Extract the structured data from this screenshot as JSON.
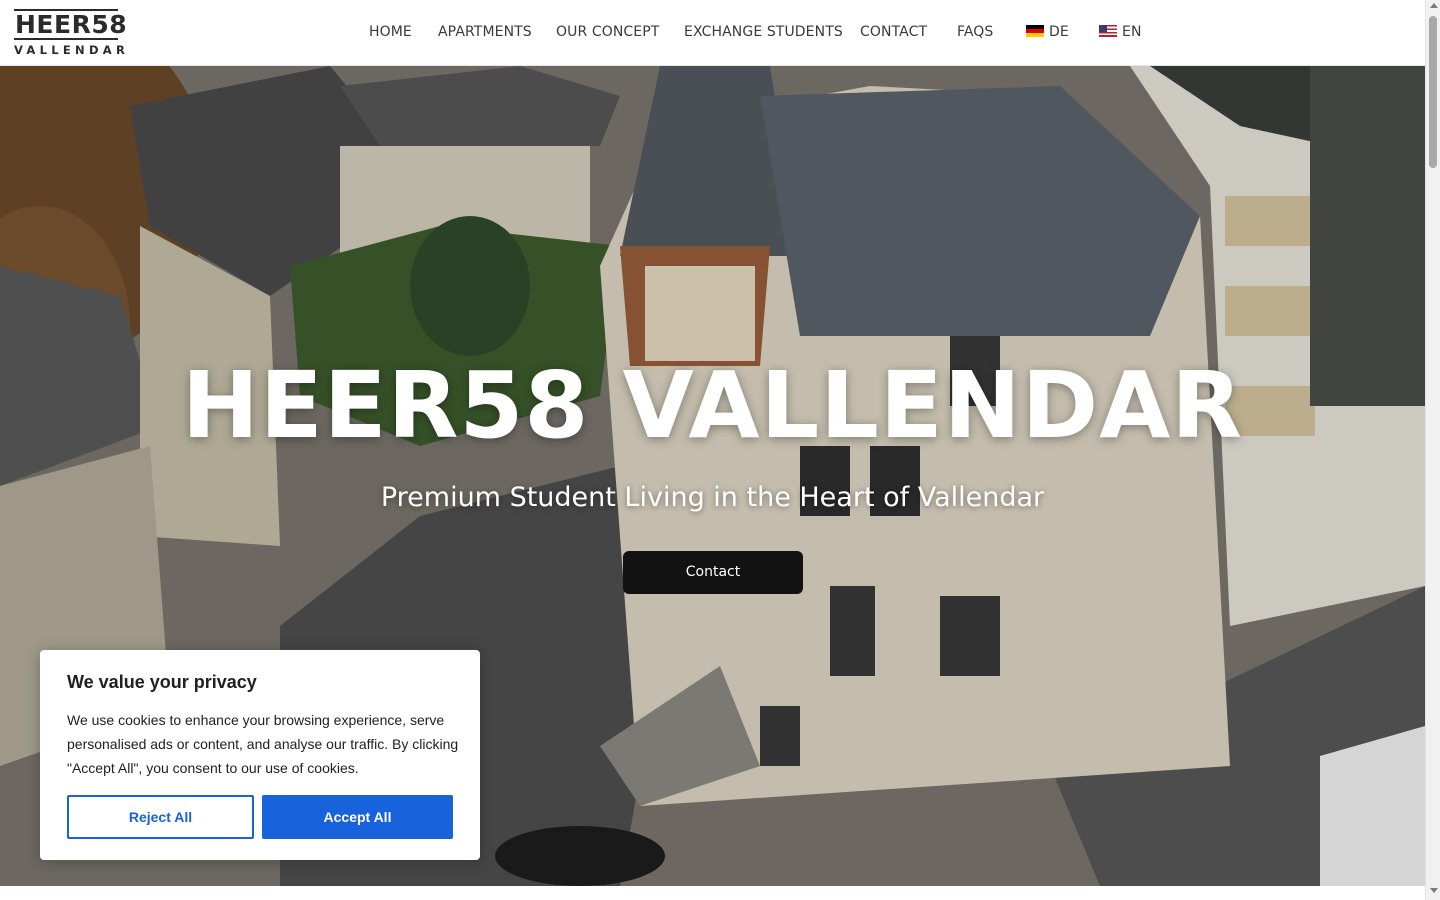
{
  "logo": {
    "top": "HEER58",
    "bottom": "VALLENDAR"
  },
  "nav": {
    "items": [
      {
        "label": "HOME"
      },
      {
        "label": "APARTMENTS"
      },
      {
        "label": "OUR CONCEPT"
      },
      {
        "label": "EXCHANGE STUDENTS"
      },
      {
        "label": "CONTACT"
      },
      {
        "label": "FAQS"
      }
    ],
    "languages": [
      {
        "label": "DE",
        "flag": "germany-flag-icon"
      },
      {
        "label": "EN",
        "flag": "usa-flag-icon"
      }
    ]
  },
  "hero": {
    "title": "HEER58 VALLENDAR",
    "subtitle": "Premium Student Living in the Heart of Vallendar",
    "button_label": "Contact"
  },
  "cookie": {
    "title": "We value your privacy",
    "text": "We use cookies to enhance your browsing experience, serve personalised ads or content, and analyse our traffic. By clicking \"Accept All\", you consent to our use of cookies.",
    "reject_label": "Reject All",
    "accept_label": "Accept All",
    "accent_color": "#1863dc"
  }
}
